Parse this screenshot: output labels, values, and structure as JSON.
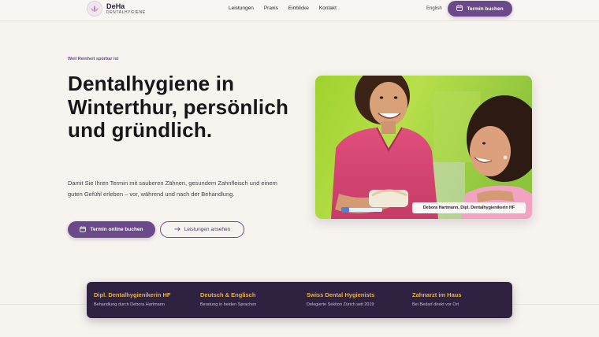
{
  "header": {
    "logo_title": "DeHa",
    "logo_subtitle": "DENTALHYGIENE",
    "nav": [
      "Leistungen",
      "Praxis",
      "Einblicke",
      "Kontakt"
    ],
    "language": "English",
    "cta_label": "Termin buchen"
  },
  "hero": {
    "eyebrow": "Weil Reinheit spürbar ist",
    "headline": "Dentalhygiene in Winterthur, persönlich und gründlich.",
    "intro": "Damit Sie Ihren Termin mit sauberen Zähnen, gesundem Zahnfleisch und einem guten Gefühl erleben – vor, während und nach der Behandlung.",
    "primary_button": "Termin online buchen",
    "secondary_button": "Leistungen ansehen",
    "photo_caption": "Debora Hartmann, Dipl. Dentalhygienikerin HF"
  },
  "features": [
    {
      "title": "Dipl. Dentalhygienikerin HF",
      "desc": "Behandlung durch Debora Hartmann"
    },
    {
      "title": "Deutsch & Englisch",
      "desc": "Beratung in beiden Sprachen"
    },
    {
      "title": "Swiss Dental Hygienists",
      "desc": "Delegierte Sektion Zürich seit 2019"
    },
    {
      "title": "Zahnarzt im Haus",
      "desc": "Bei Bedarf direkt vor Ort"
    }
  ],
  "colors": {
    "background": "#f7f3ef",
    "accent": "#6b4a8a",
    "strip_background": "#2e2240",
    "strip_title": "#e5b24a"
  },
  "icons": {
    "logo": "lotus-icon",
    "calendar": "calendar-icon",
    "arrow": "arrow-right-icon"
  }
}
